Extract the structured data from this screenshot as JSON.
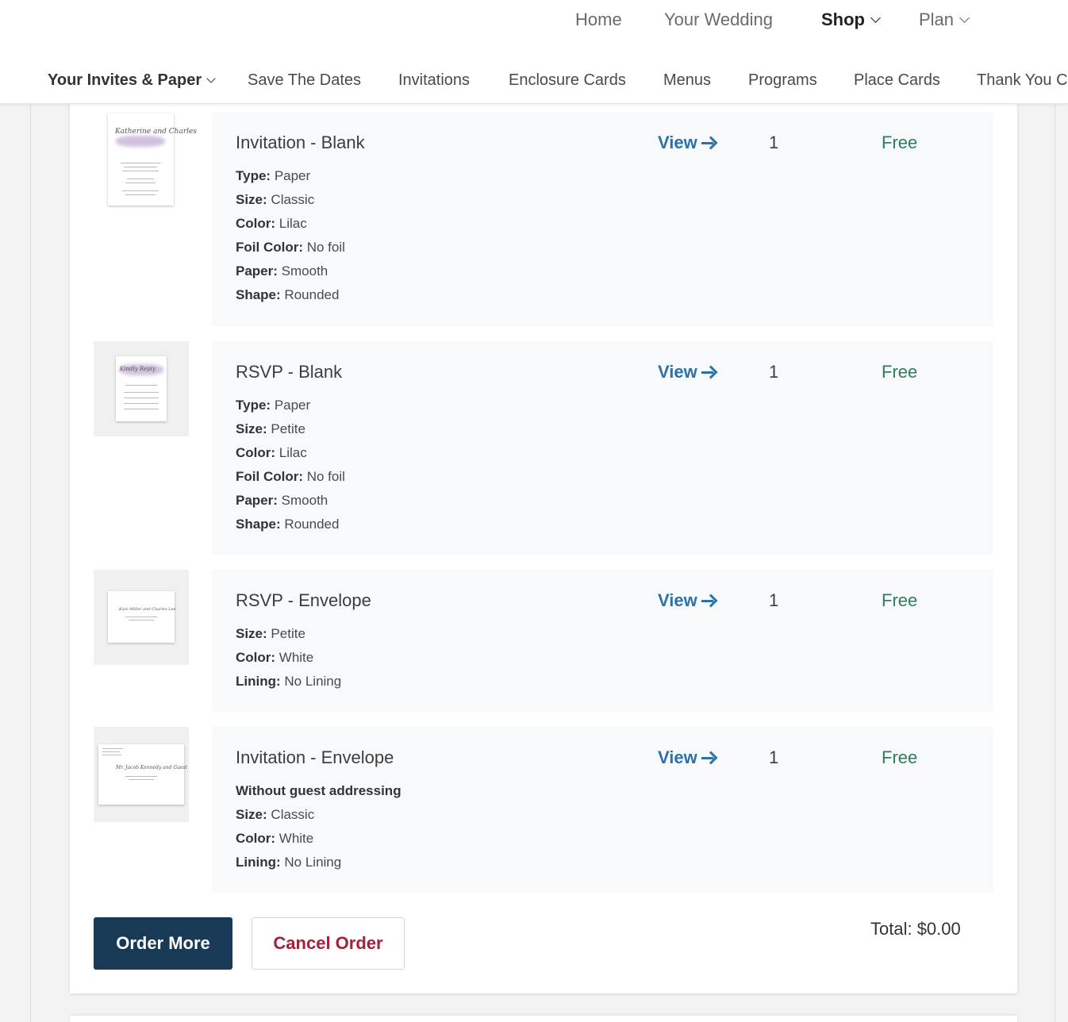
{
  "top_nav": {
    "items": [
      {
        "label": "Home"
      },
      {
        "label": "Your Wedding"
      },
      {
        "label": "Shop"
      },
      {
        "label": "Plan"
      }
    ]
  },
  "sub_nav": {
    "items": [
      {
        "label": "Your Invites & Paper"
      },
      {
        "label": "Save The Dates"
      },
      {
        "label": "Invitations"
      },
      {
        "label": "Enclosure Cards"
      },
      {
        "label": "Menus"
      },
      {
        "label": "Programs"
      },
      {
        "label": "Place Cards"
      },
      {
        "label": "Thank You C"
      }
    ]
  },
  "order": {
    "view_label": "View",
    "items": [
      {
        "title": "Invitation - Blank",
        "quantity": "1",
        "price": "Free",
        "thumb_text": "Katherine and Charles",
        "attributes": [
          {
            "label": "Type:",
            "value": "Paper"
          },
          {
            "label": "Size:",
            "value": "Classic"
          },
          {
            "label": "Color:",
            "value": "Lilac"
          },
          {
            "label": "Foil Color:",
            "value": "No foil"
          },
          {
            "label": "Paper:",
            "value": "Smooth"
          },
          {
            "label": "Shape:",
            "value": "Rounded"
          }
        ]
      },
      {
        "title": "RSVP - Blank",
        "quantity": "1",
        "price": "Free",
        "thumb_text": "Kindly Reply",
        "attributes": [
          {
            "label": "Type:",
            "value": "Paper"
          },
          {
            "label": "Size:",
            "value": "Petite"
          },
          {
            "label": "Color:",
            "value": "Lilac"
          },
          {
            "label": "Foil Color:",
            "value": "No foil"
          },
          {
            "label": "Paper:",
            "value": "Smooth"
          },
          {
            "label": "Shape:",
            "value": "Rounded"
          }
        ]
      },
      {
        "title": "RSVP - Envelope",
        "quantity": "1",
        "price": "Free",
        "thumb_text": "Kate Miller and Charles Lee",
        "attributes": [
          {
            "label": "Size:",
            "value": "Petite"
          },
          {
            "label": "Color:",
            "value": "White"
          },
          {
            "label": "Lining:",
            "value": "No Lining"
          }
        ]
      },
      {
        "title": "Invitation - Envelope",
        "quantity": "1",
        "price": "Free",
        "thumb_text": "Mr. Jacob Kennedy and Guest",
        "note": "Without guest addressing",
        "attributes": [
          {
            "label": "Size:",
            "value": "Classic"
          },
          {
            "label": "Color:",
            "value": "White"
          },
          {
            "label": "Lining:",
            "value": "No Lining"
          }
        ]
      }
    ],
    "order_more_label": "Order More",
    "cancel_label": "Cancel Order",
    "total_label": "Total: $0.00"
  },
  "colors": {
    "primary_button": "#183a57",
    "cancel_text": "#a3213a",
    "link": "#2a72a8",
    "price": "#2e7d5b",
    "panel_bg": "#f8f9fb"
  }
}
